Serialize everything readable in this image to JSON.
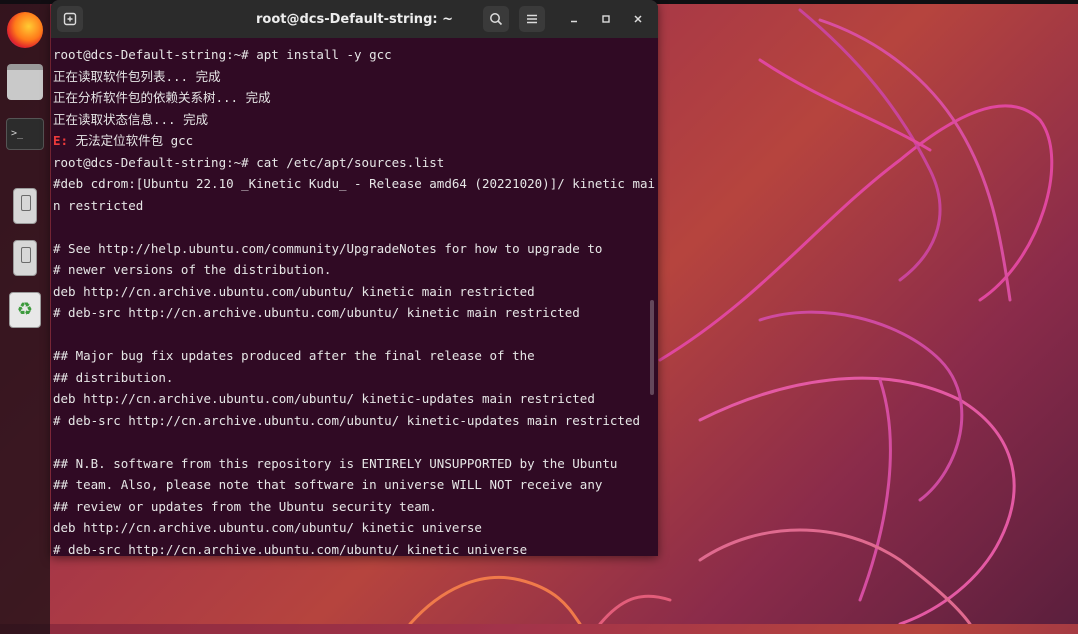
{
  "window": {
    "title": "root@dcs-Default-string: ~"
  },
  "dock": {
    "items": [
      "firefox-icon",
      "files-icon",
      "terminal-icon",
      "usb-drive-icon",
      "usb-drive-icon",
      "trash-icon"
    ]
  },
  "terminal": {
    "lines": [
      {
        "text": "root@dcs-Default-string:~# apt install -y gcc"
      },
      {
        "text": "正在读取软件包列表... 完成"
      },
      {
        "text": "正在分析软件包的依赖关系树... 完成"
      },
      {
        "text": "正在读取状态信息... 完成"
      },
      {
        "tag": "E:",
        "text": " 无法定位软件包 gcc"
      },
      {
        "text": "root@dcs-Default-string:~# cat /etc/apt/sources.list"
      },
      {
        "text": "#deb cdrom:[Ubuntu 22.10 _Kinetic Kudu_ - Release amd64 (20221020)]/ kinetic mai"
      },
      {
        "text": "n restricted"
      },
      {
        "text": ""
      },
      {
        "text": "# See http://help.ubuntu.com/community/UpgradeNotes for how to upgrade to"
      },
      {
        "text": "# newer versions of the distribution."
      },
      {
        "text": "deb http://cn.archive.ubuntu.com/ubuntu/ kinetic main restricted"
      },
      {
        "text": "# deb-src http://cn.archive.ubuntu.com/ubuntu/ kinetic main restricted"
      },
      {
        "text": ""
      },
      {
        "text": "## Major bug fix updates produced after the final release of the"
      },
      {
        "text": "## distribution."
      },
      {
        "text": "deb http://cn.archive.ubuntu.com/ubuntu/ kinetic-updates main restricted"
      },
      {
        "text": "# deb-src http://cn.archive.ubuntu.com/ubuntu/ kinetic-updates main restricted"
      },
      {
        "text": ""
      },
      {
        "text": "## N.B. software from this repository is ENTIRELY UNSUPPORTED by the Ubuntu"
      },
      {
        "text": "## team. Also, please note that software in universe WILL NOT receive any"
      },
      {
        "text": "## review or updates from the Ubuntu security team."
      },
      {
        "text": "deb http://cn.archive.ubuntu.com/ubuntu/ kinetic universe"
      },
      {
        "text": "# deb-src http://cn.archive.ubuntu.com/ubuntu/ kinetic universe"
      }
    ]
  },
  "colors": {
    "terminal_bg": "#300a24",
    "error": "#ef3b3b",
    "accent": "#e95420"
  }
}
